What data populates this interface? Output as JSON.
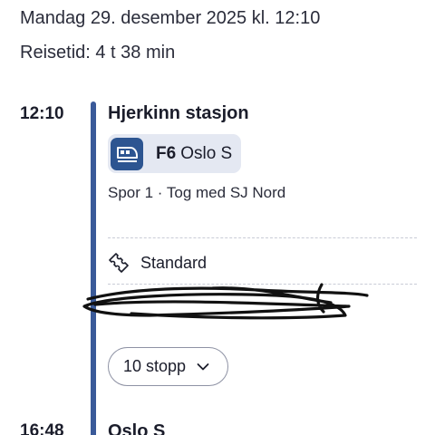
{
  "header": {
    "date_time": "Mandag 29. desember 2025 kl. 12:10",
    "travel_time": "Reisetid: 4 t 38 min"
  },
  "departure": {
    "time": "12:10",
    "station": "Hjerkinn stasjon",
    "line": {
      "code": "F6",
      "destination": "Oslo S",
      "icon": "train-icon",
      "color": "#2d5591"
    },
    "platform_info": "Spor 1 · Tog med SJ Nord",
    "ticket": {
      "icon": "ticket-icon",
      "label": "Standard"
    },
    "stops_button": "10 stopp"
  },
  "arrival": {
    "time": "16:48",
    "station": "Oslo S"
  },
  "colors": {
    "timeline": "#3a5a99",
    "chip_bg": "#e4e8f2"
  }
}
